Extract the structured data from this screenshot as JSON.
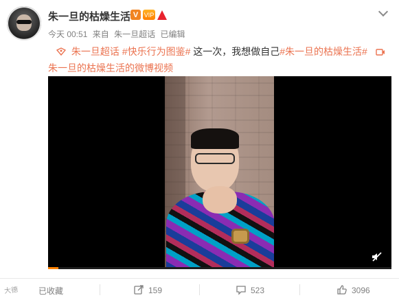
{
  "post": {
    "username": "朱一旦的枯燥生活",
    "badges": [
      "V",
      "VIP",
      "brand"
    ],
    "meta": {
      "time": "今天 00:51",
      "source_prefix": "来自",
      "source": "朱一旦超话",
      "edited": "已编辑"
    },
    "content": {
      "supertopic": "朱一旦超话",
      "hashtag1": "#快乐行为图鉴#",
      "text": "这一次，我想做自己",
      "hashtag2": "#朱一旦的枯燥生活#",
      "video_link": "朱一旦的枯燥生活的微博视频"
    },
    "video": {
      "progress": 0.03,
      "muted": true
    },
    "actions": {
      "favorite": "已收藏",
      "repost": "159",
      "comment": "523",
      "like": "3096"
    },
    "watermark": "大德"
  },
  "colors": {
    "link": "#eb7350",
    "badge_orange": "#f18422",
    "badge_red": "#e8222e",
    "progress": "#ff8200"
  },
  "icons": [
    "chevron-down-icon",
    "supertopic-icon",
    "video-icon",
    "mute-icon",
    "repost-icon",
    "comment-icon",
    "like-icon"
  ]
}
